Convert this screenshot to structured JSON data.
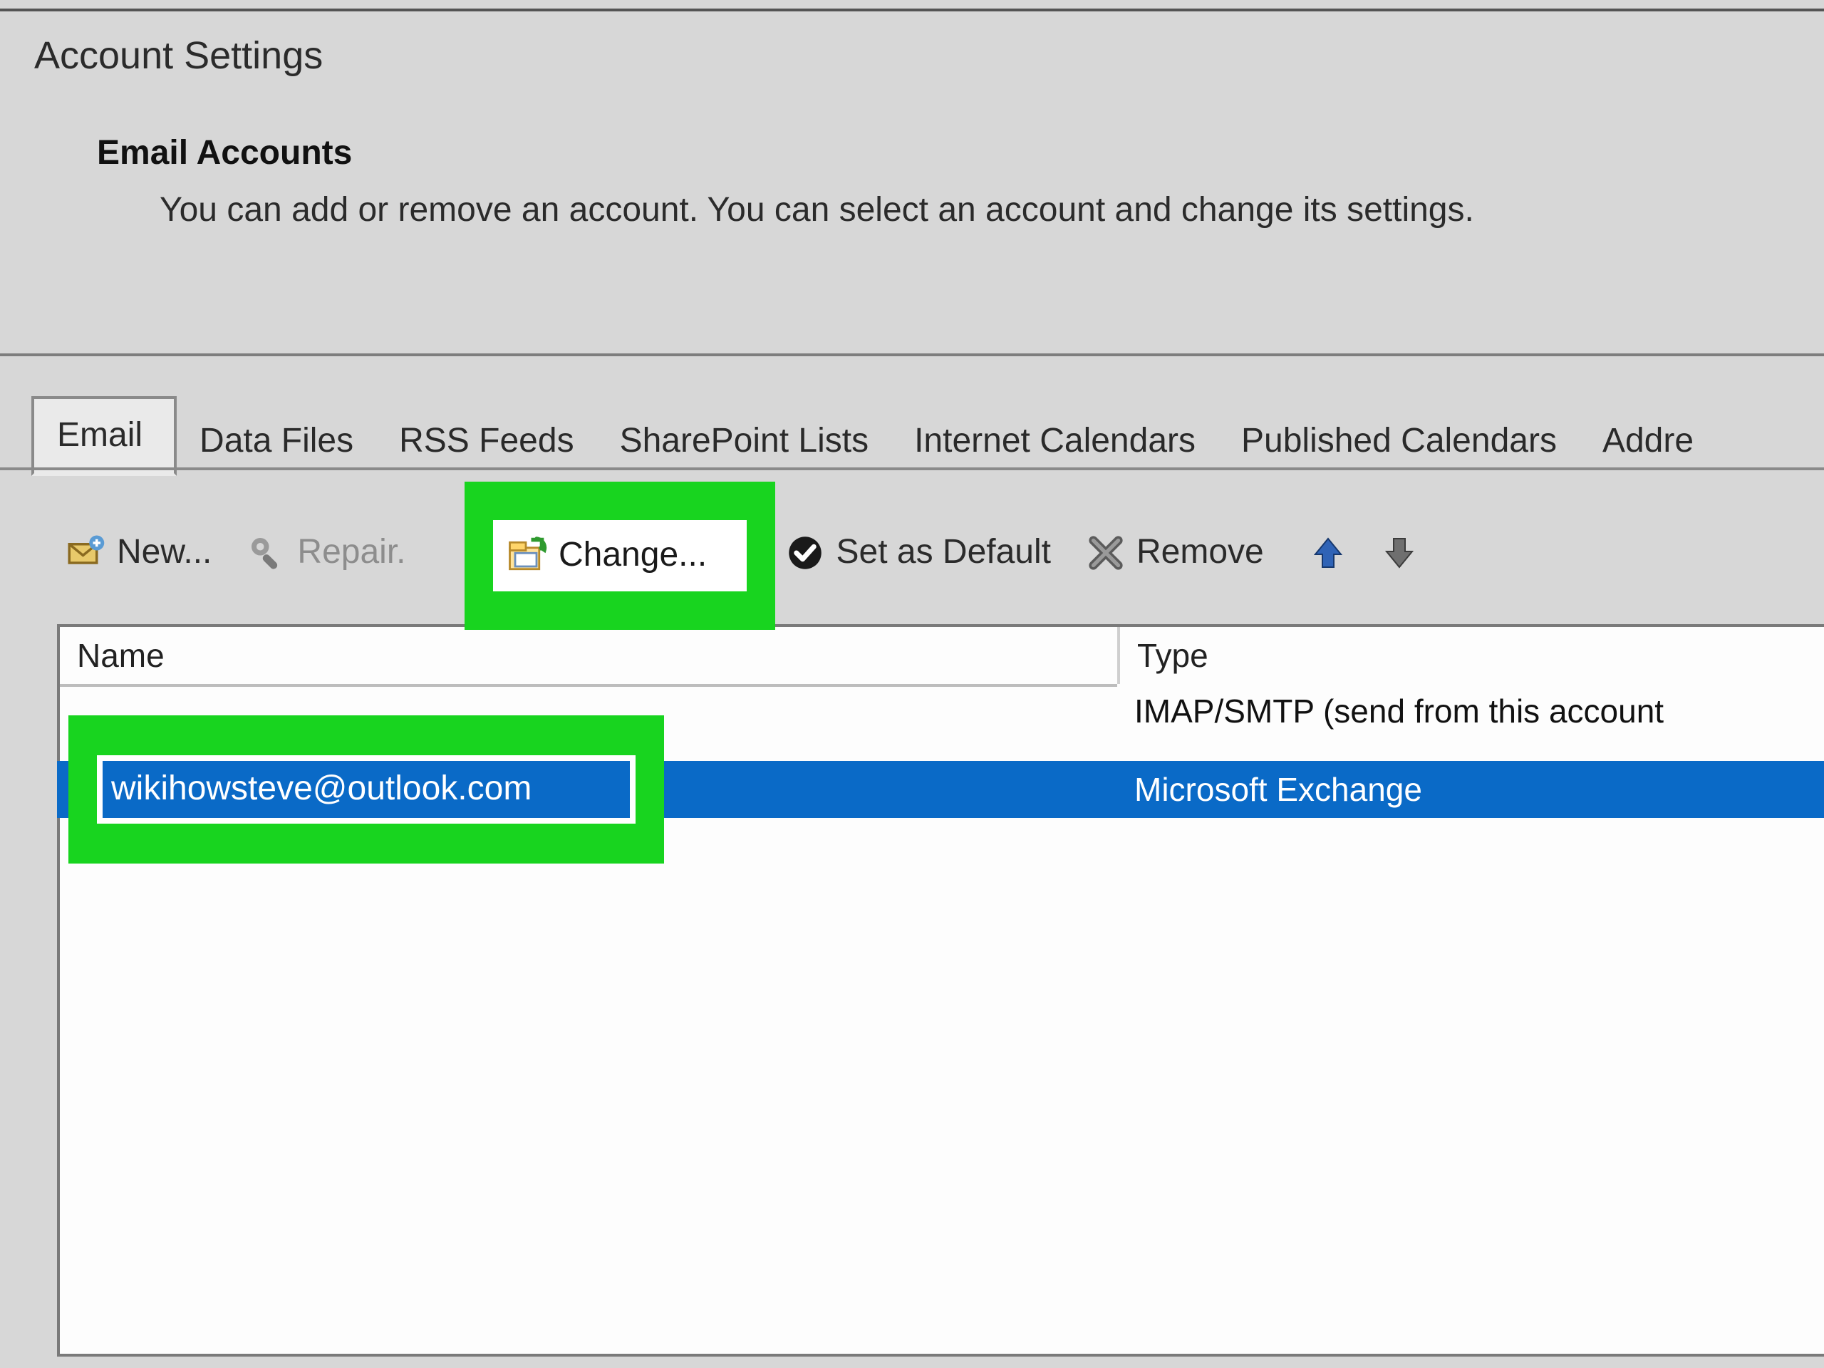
{
  "window": {
    "title": "Account Settings",
    "section_title": "Email Accounts",
    "section_description": "You can add or remove an account. You can select an account and change its settings."
  },
  "tabs": [
    {
      "label": "Email",
      "active": true
    },
    {
      "label": "Data Files",
      "active": false
    },
    {
      "label": "RSS Feeds",
      "active": false
    },
    {
      "label": "SharePoint Lists",
      "active": false
    },
    {
      "label": "Internet Calendars",
      "active": false
    },
    {
      "label": "Published Calendars",
      "active": false
    },
    {
      "label": "Addre",
      "active": false
    }
  ],
  "toolbar": {
    "new_label": "New...",
    "repair_label": "Repair.",
    "change_label": "Change...",
    "default_label": "Set as Default",
    "remove_label": "Remove"
  },
  "table": {
    "columns": {
      "name": "Name",
      "type": "Type"
    },
    "rows": [
      {
        "name": "",
        "type": "IMAP/SMTP (send from this account",
        "selected": false
      },
      {
        "name": "wikihowsteve@outlook.com",
        "type": "Microsoft Exchange",
        "selected": true
      }
    ]
  },
  "highlight": {
    "change_button": true,
    "selected_email": true,
    "color": "#18d41f"
  }
}
